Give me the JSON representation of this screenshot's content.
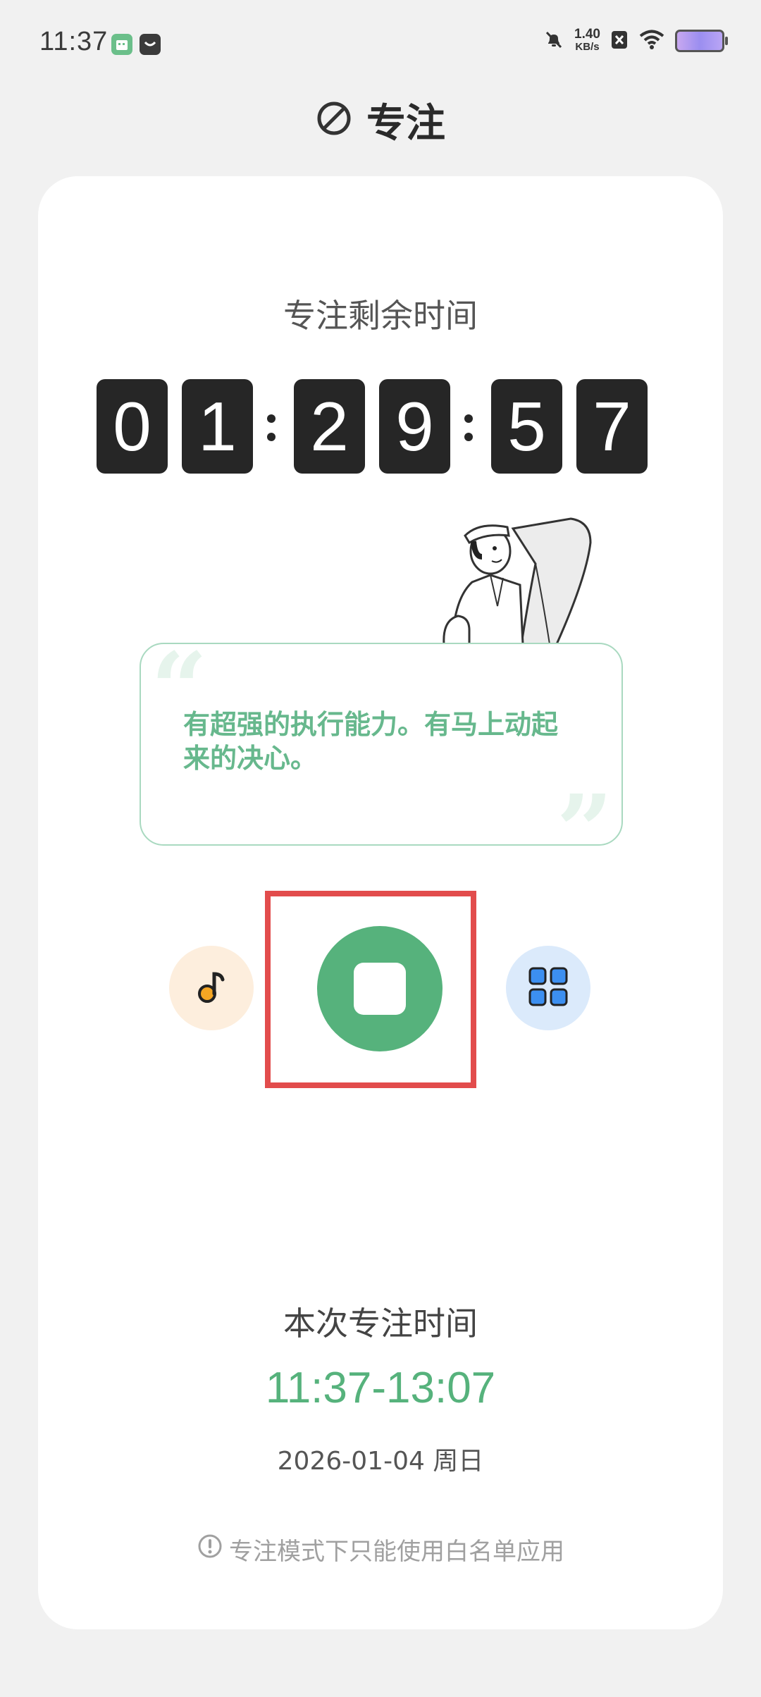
{
  "status_bar": {
    "time": "11:37",
    "net_speed_value": "1.40",
    "net_speed_unit": "KB/s"
  },
  "header": {
    "title": "专注",
    "icon": "prohibit-circle-icon"
  },
  "timer": {
    "label": "专注剩余时间",
    "digits": [
      "0",
      "1",
      "2",
      "9",
      "5",
      "7"
    ]
  },
  "quote": {
    "text": "有超强的执行能力。有马上动起来的决心。"
  },
  "controls": {
    "music_icon": "music-note-icon",
    "stop_icon": "stop-icon",
    "apps_icon": "apps-grid-icon"
  },
  "session": {
    "label": "本次专注时间",
    "range": "11:37-13:07",
    "date": "2026-01-04 周日"
  },
  "notice": {
    "text": "专注模式下只能使用白名单应用",
    "icon": "info-exclamation-icon"
  },
  "colors": {
    "accent_green": "#56b27c",
    "highlight_red": "#e24c4c",
    "digit_bg": "#262626"
  }
}
